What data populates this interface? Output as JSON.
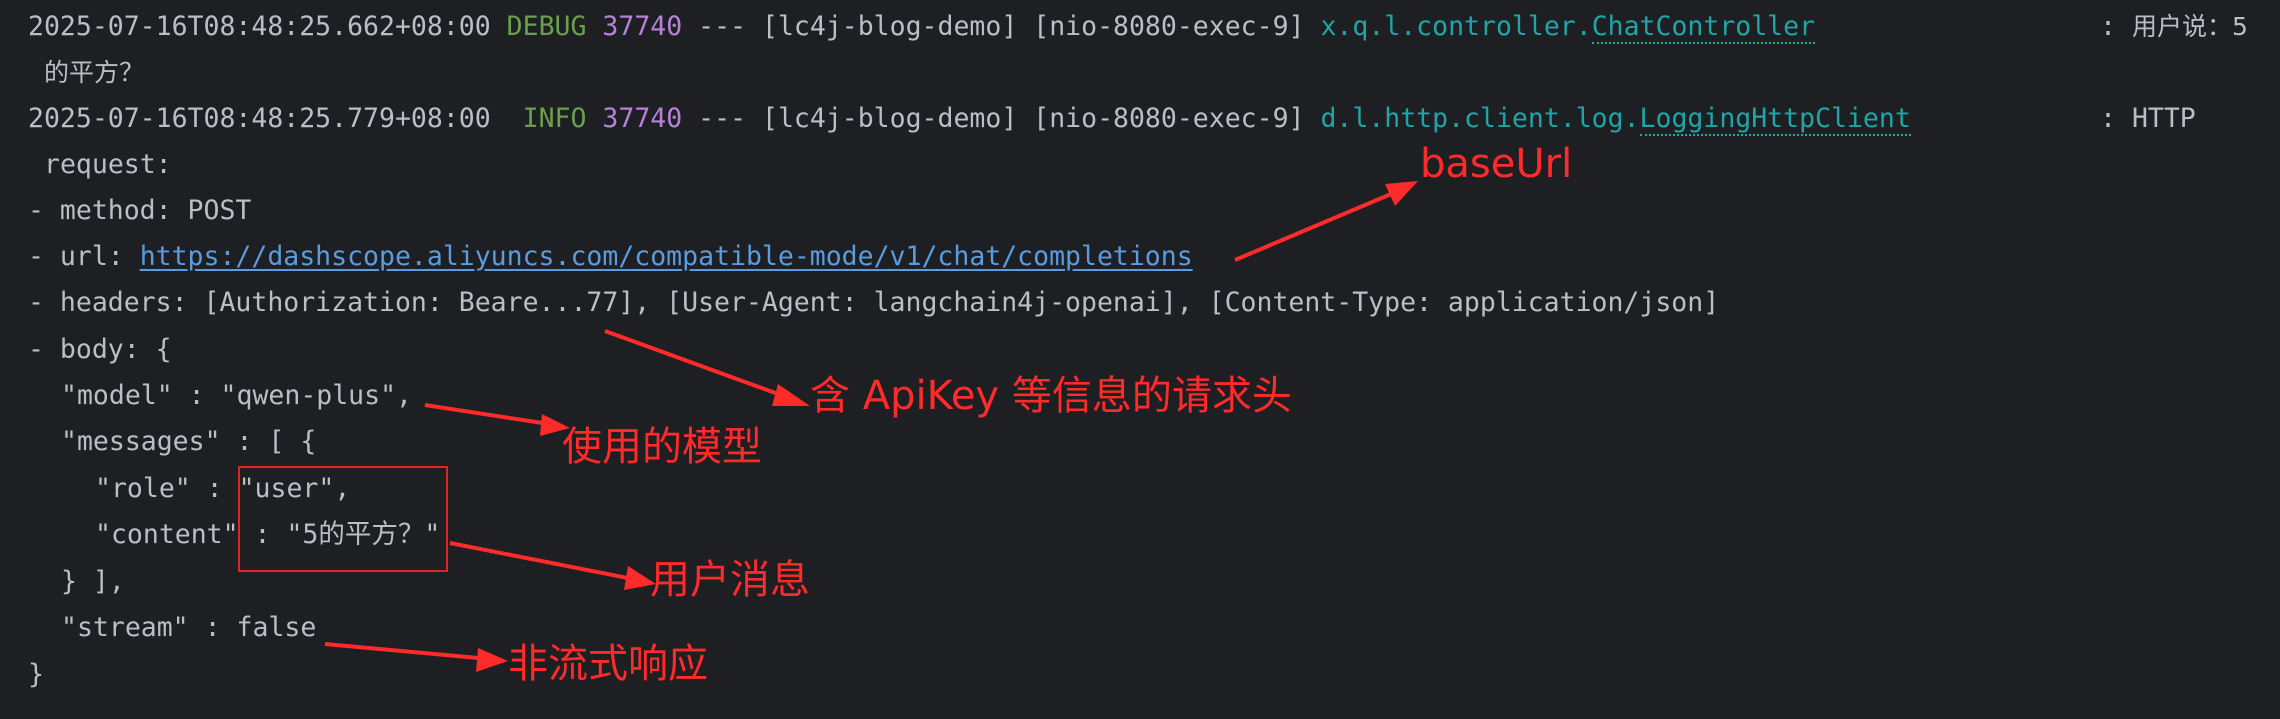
{
  "log": {
    "line1": {
      "timestamp": "2025-07-16T08:48:25.662+08:00",
      "level": "DEBUG",
      "pid": "37740",
      "sep": "---",
      "app": "[lc4j-blog-demo]",
      "thread": "[nio-8080-exec-9]",
      "logger_pkg": "x.q.l.controller.",
      "logger_cls": "ChatController",
      "colon": ":",
      "message": "用户说：5"
    },
    "line1_cont": "的平方？",
    "line2": {
      "timestamp": "2025-07-16T08:48:25.779+08:00",
      "level": "INFO",
      "pid": "37740",
      "sep": "---",
      "app": "[lc4j-blog-demo]",
      "thread": "[nio-8080-exec-9]",
      "logger_pkg": "d.l.http.client.log.",
      "logger_cls": "LoggingHttpClient",
      "colon": ":",
      "message": "HTTP"
    },
    "line2_cont": "request:",
    "method": "- method: POST",
    "url_prefix": "- url: ",
    "url": "https://dashscope.aliyuncs.com/compatible-mode/v1/chat/completions",
    "headers": "- headers: [Authorization: Beare...77], [User-Agent: langchain4j-openai], [Content-Type: application/json]",
    "body_open": "- body: {",
    "model": "\"model\" : \"qwen-plus\",",
    "messages_open": "\"messages\" : [ {",
    "role": "\"role\" : \"user\",",
    "content": "\"content\" : \"5的平方？\"",
    "messages_close": "} ],",
    "stream": "\"stream\" : false",
    "body_close": "}"
  },
  "annotations": {
    "base_url": "baseUrl",
    "headers_note": "含 ApiKey 等信息的请求头",
    "model_note": "使用的模型",
    "user_msg_note": "用户消息",
    "stream_note": "非流式响应"
  },
  "colors": {
    "background": "#1e1f22",
    "text": "#bcbec4",
    "level": "#6a9f4d",
    "pid": "#b881d9",
    "logger": "#20a5a6",
    "link": "#5b9be0",
    "annotation": "#ff2a2a"
  }
}
